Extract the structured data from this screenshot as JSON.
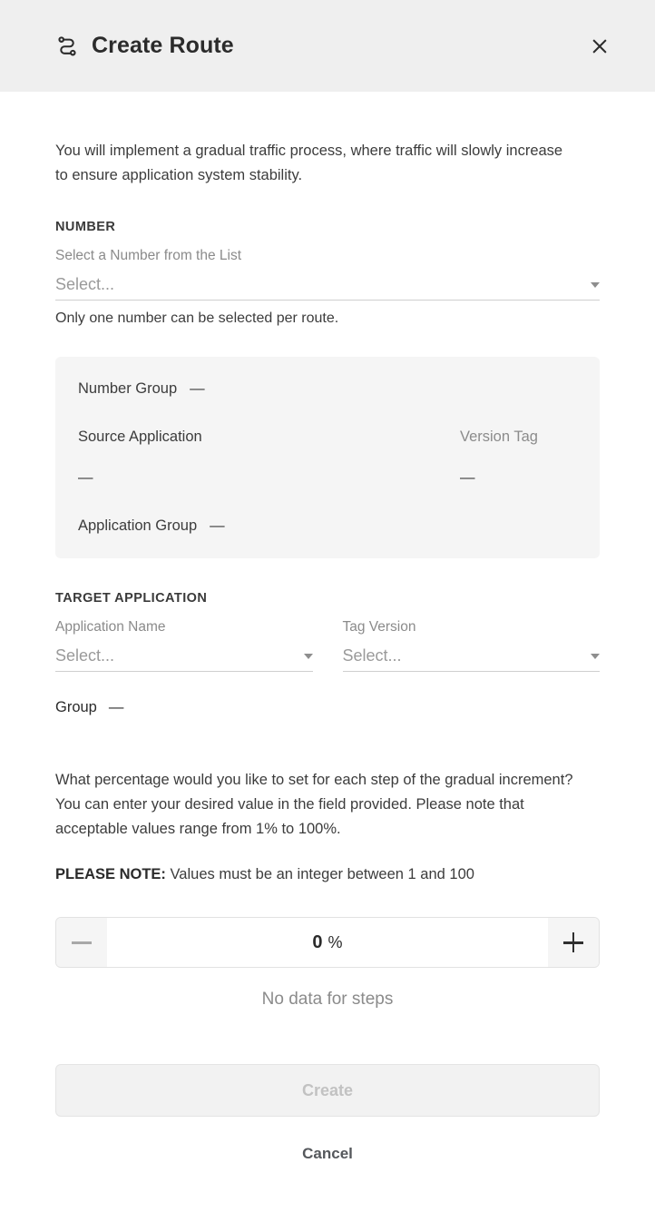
{
  "header": {
    "title": "Create Route",
    "icon": "route-icon",
    "close_icon": "close-icon"
  },
  "intro": "You will implement a gradual traffic process, where traffic will slowly increase to ensure application system stability.",
  "number_section": {
    "label": "NUMBER",
    "field_label": "Select a Number from the List",
    "field_value": "Select...",
    "hint": "Only one number can be selected per route."
  },
  "info_card": {
    "number_group_key": "Number Group",
    "number_group_value": "—",
    "source_application_key": "Source Application",
    "source_application_value": "—",
    "version_tag_key": "Version Tag",
    "version_tag_value": "—",
    "application_group_key": "Application Group",
    "application_group_value": "—"
  },
  "target_section": {
    "label": "TARGET APPLICATION",
    "application_name_label": "Application Name",
    "application_name_value": "Select...",
    "tag_version_label": "Tag Version",
    "tag_version_value": "Select...",
    "group_key": "Group",
    "group_value": "—"
  },
  "percentage": {
    "description": "What percentage would you like to set for each step of the gradual increment? You can enter your desired value in the field provided. Please note that acceptable values range from 1% to 100%.",
    "note_prefix": "PLEASE NOTE:",
    "note_text": " Values must be an integer between 1 and 100",
    "stepper_value": "0",
    "stepper_unit": "%",
    "decrement_label": "−",
    "increment_label": "+",
    "empty_state": "No data for steps"
  },
  "footer": {
    "create_label": "Create",
    "cancel_label": "Cancel"
  },
  "colors": {
    "header_bg": "#efefef",
    "card_bg": "#f5f5f5",
    "text": "#3c3c3c",
    "muted": "#8b8b8b",
    "divider": "#cfcfcf"
  }
}
